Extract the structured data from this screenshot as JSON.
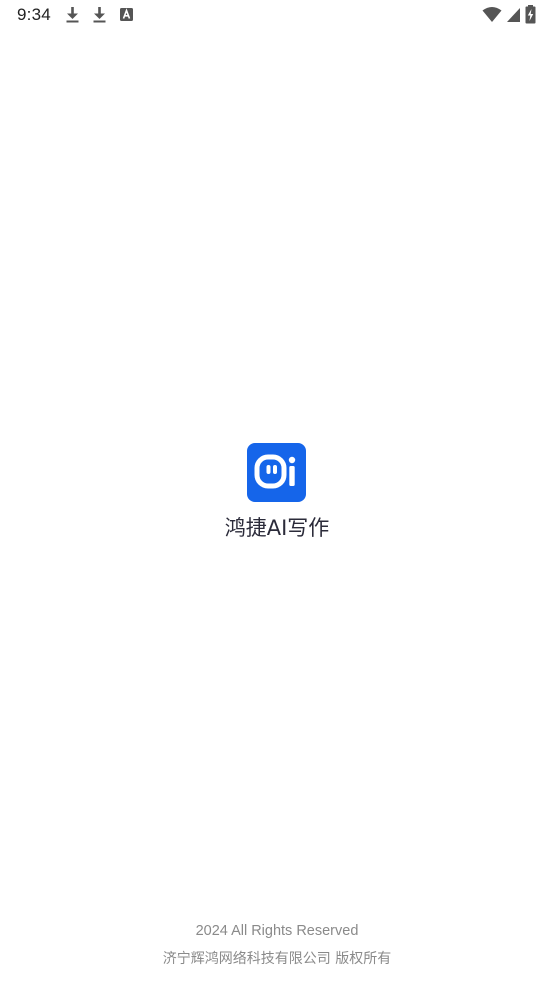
{
  "status_bar": {
    "time": "9:34",
    "left_icons": [
      "download-icon",
      "download-icon",
      "font-a-icon"
    ],
    "right_icons": [
      "wifi-icon",
      "signal-icon",
      "battery-charging-icon"
    ]
  },
  "splash": {
    "logo_icon": "app-logo-icon",
    "logo_color": "#1565ea",
    "app_name": "鸿捷AI写作"
  },
  "footer": {
    "copyright": "2024 All Rights Reserved",
    "company": "济宁辉鸿网络科技有限公司 版权所有"
  }
}
